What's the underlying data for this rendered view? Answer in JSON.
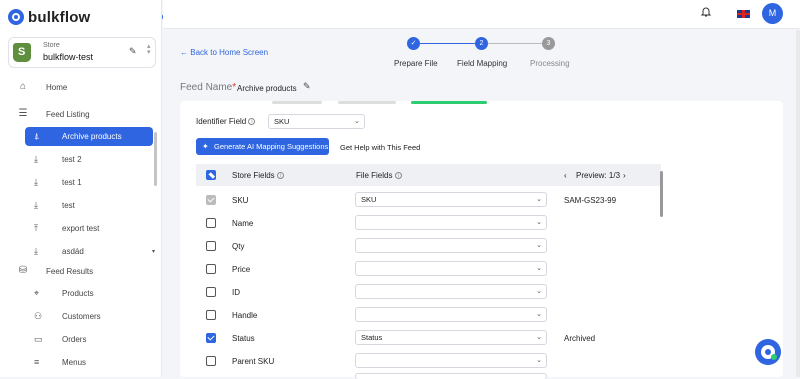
{
  "brand": {
    "name": "bulkflow"
  },
  "store": {
    "label": "Store",
    "name": "bulkflow-test"
  },
  "sidebar": {
    "home": "Home",
    "feed_listing": "Feed Listing",
    "feeds": [
      "Archive products",
      "test 2",
      "test 1",
      "test",
      "export test",
      "asdád"
    ],
    "feed_results": "Feed Results",
    "results": [
      "Products",
      "Customers",
      "Orders",
      "Menus"
    ]
  },
  "topbar": {
    "avatar_initial": "M"
  },
  "stepper": {
    "back_label": "Back to Home Screen",
    "steps": [
      {
        "num": "✓",
        "label": "Prepare File"
      },
      {
        "num": "2",
        "label": "Field Mapping"
      },
      {
        "num": "3",
        "label": "Processing"
      }
    ]
  },
  "feed": {
    "name_label": "Feed Name",
    "required": "*",
    "name_value": "Archive products"
  },
  "identifier": {
    "label": "Identifier Field",
    "value": "SKU"
  },
  "actions": {
    "generate_ai": "Generate AI Mapping Suggestions",
    "help": "Get Help with This Feed"
  },
  "table": {
    "col_store": "Store Fields",
    "col_file": "File Fields",
    "preview": "Preview: 1/3",
    "rows": [
      {
        "field": "SKU",
        "file": "SKU",
        "preview": "SAM-GS23-99",
        "state": "disabled"
      },
      {
        "field": "Name",
        "file": "",
        "preview": "",
        "state": "off"
      },
      {
        "field": "Qty",
        "file": "",
        "preview": "",
        "state": "off"
      },
      {
        "field": "Price",
        "file": "",
        "preview": "",
        "state": "off"
      },
      {
        "field": "ID",
        "file": "",
        "preview": "",
        "state": "off"
      },
      {
        "field": "Handle",
        "file": "",
        "preview": "",
        "state": "off"
      },
      {
        "field": "Status",
        "file": "Status",
        "preview": "Archived",
        "state": "on"
      },
      {
        "field": "Parent SKU",
        "file": "",
        "preview": "",
        "state": "off"
      }
    ]
  },
  "colors": {
    "accent": "#2f65e0",
    "success": "#2ecc71"
  }
}
